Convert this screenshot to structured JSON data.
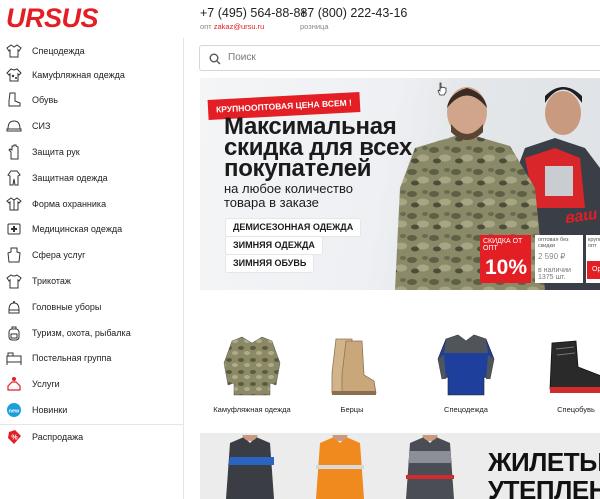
{
  "header": {
    "logo": "URSUS",
    "phone1": "+7 (495) 564-88-88",
    "phone1_prefix": "опт ",
    "email": "zakaz@ursu.ru",
    "phone2": "+7 (800) 222-43-16",
    "phone2_sub": "розница"
  },
  "sidebar": {
    "items": [
      {
        "label": "Спецодежда",
        "icon": "jacket-icon"
      },
      {
        "label": "Камуфляжная одежда",
        "icon": "camo-shirt-icon"
      },
      {
        "label": "Обувь",
        "icon": "boot-icon"
      },
      {
        "label": "СИЗ",
        "icon": "helmet-icon"
      },
      {
        "label": "Защита рук",
        "icon": "glove-icon"
      },
      {
        "label": "Защитная одежда",
        "icon": "coverall-icon"
      },
      {
        "label": "Форма охранника",
        "icon": "uniform-icon"
      },
      {
        "label": "Медицинская одежда",
        "icon": "medical-coat-icon"
      },
      {
        "label": "Сфера услуг",
        "icon": "apron-icon"
      },
      {
        "label": "Трикотаж",
        "icon": "tshirt-icon"
      },
      {
        "label": "Головные уборы",
        "icon": "cap-icon"
      },
      {
        "label": "Туризм, охота, рыбалка",
        "icon": "backpack-icon"
      },
      {
        "label": "Постельная группа",
        "icon": "bedding-icon"
      },
      {
        "label": "Услуги",
        "icon": "service-icon"
      },
      {
        "label": "Новинки",
        "icon": "new-badge-icon"
      },
      {
        "label": "Распродажа",
        "icon": "sale-tag-icon"
      }
    ]
  },
  "search": {
    "placeholder": "Поиск"
  },
  "banner": {
    "ribbon": "КРУПНООПТОВАЯ ЦЕНА ВСЕМ !",
    "title_line1": "Максимальная",
    "title_line2": "скидка для всех",
    "title_line3": "покупателей",
    "subtitle_line1": "на любое количество",
    "subtitle_line2": "товара в заказе",
    "pills": [
      "ДЕМИСЕЗОННАЯ ОДЕЖДА",
      "ЗИМНЯЯ ОДЕЖДА",
      "ЗИМНЯЯ ОБУВЬ"
    ],
    "badge_text": "СКИДКА ОТ ОПТ",
    "badge_value": "10%",
    "price_caption": "оптовая без скидки",
    "price_value": "2 590 ₽",
    "stock": "в наличии 1375 шт.",
    "price_caption2": "крупный опт",
    "order": "Ор",
    "vawa": "ваш",
    "slides": 4,
    "active_slide": 0
  },
  "categories": [
    {
      "label": "Камуфляжная одежда",
      "icon": "camo-jacket-image"
    },
    {
      "label": "Берцы",
      "icon": "boots-image"
    },
    {
      "label": "Спецодежда",
      "icon": "workwear-image"
    },
    {
      "label": "Спецобувь",
      "icon": "safety-shoe-image"
    }
  ],
  "promo": {
    "title_line1": "ЖИЛЕТЫ",
    "title_line2": "УТЕПЛЕНН"
  },
  "colors": {
    "accent": "#e31e24",
    "text": "#222222"
  }
}
